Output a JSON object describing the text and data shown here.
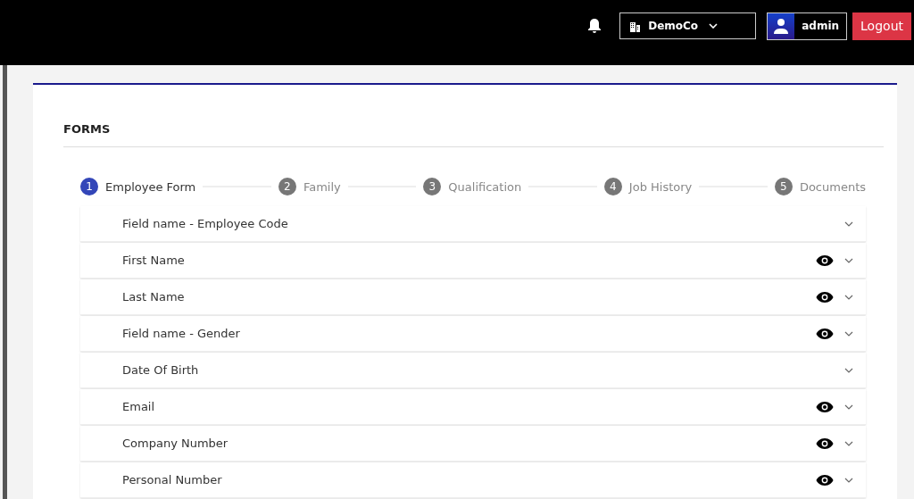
{
  "header": {
    "company": "DemoCo",
    "user": "admin",
    "logout": "Logout"
  },
  "page_title": "FORMS",
  "steps": [
    {
      "number": "1",
      "label": "Employee Form",
      "selected": true
    },
    {
      "number": "2",
      "label": "Family",
      "selected": false
    },
    {
      "number": "3",
      "label": "Qualification",
      "selected": false
    },
    {
      "number": "4",
      "label": "Job History",
      "selected": false
    },
    {
      "number": "5",
      "label": "Documents",
      "selected": false
    }
  ],
  "fields": [
    {
      "label": "Field name - Employee Code",
      "visible": false
    },
    {
      "label": "First Name",
      "visible": true
    },
    {
      "label": "Last Name",
      "visible": true
    },
    {
      "label": "Field name - Gender",
      "visible": true
    },
    {
      "label": "Date Of Birth",
      "visible": false
    },
    {
      "label": "Email",
      "visible": true
    },
    {
      "label": "Company Number",
      "visible": true
    },
    {
      "label": "Personal Number",
      "visible": true
    }
  ]
}
